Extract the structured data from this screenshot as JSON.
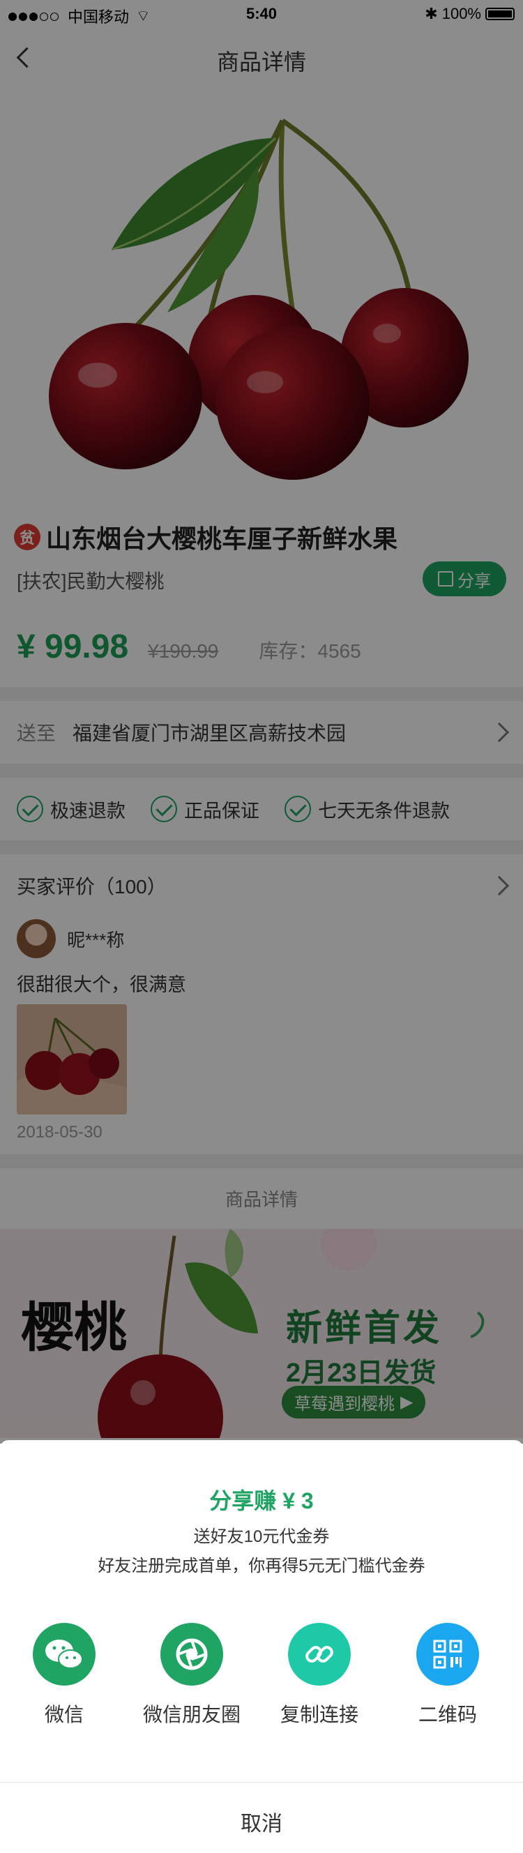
{
  "status_bar": {
    "carrier": "中国移动",
    "time": "5:40",
    "battery": "100%"
  },
  "nav": {
    "title": "商品详情"
  },
  "product": {
    "badge": "贫",
    "title": "山东烟台大樱桃车厘子新鲜水果",
    "subtitle": "[扶农]民勤大樱桃",
    "share_label": "分享",
    "price": "¥ 99.98",
    "original_price": "¥190.99",
    "stock": "库存：4565"
  },
  "shipping": {
    "label": "送至",
    "address": "福建省厦门市湖里区高薪技术园"
  },
  "guarantees": [
    "极速退款",
    "正品保证",
    "七天无条件退款"
  ],
  "reviews": {
    "header": "买家评价（100）",
    "reviewer": "昵***称",
    "text": "很甜很大个，很满意",
    "date": "2018-05-30"
  },
  "detail": {
    "section_title": "商品详情",
    "banner_logo": "樱桃",
    "banner_main": "新鲜首发",
    "banner_date": "2月23日发货",
    "banner_pill": "草莓遇到樱桃"
  },
  "share_sheet": {
    "title": "分享赚 ¥ 3",
    "sub1": "送好友10元代金券",
    "sub2": "好友注册完成首单，你再得5元无门槛代金券",
    "options": [
      {
        "label": "微信",
        "icon": "wechat-icon",
        "color": "#1fa463"
      },
      {
        "label": "微信朋友圈",
        "icon": "moments-icon",
        "color": "#1fa463"
      },
      {
        "label": "复制连接",
        "icon": "link-icon",
        "color": "#1ec9a8"
      },
      {
        "label": "二维码",
        "icon": "qrcode-icon",
        "color": "#1aa7f0"
      }
    ],
    "cancel": "取消"
  },
  "colors": {
    "brand_green": "#1fa463",
    "price_green": "#1a9e56"
  }
}
